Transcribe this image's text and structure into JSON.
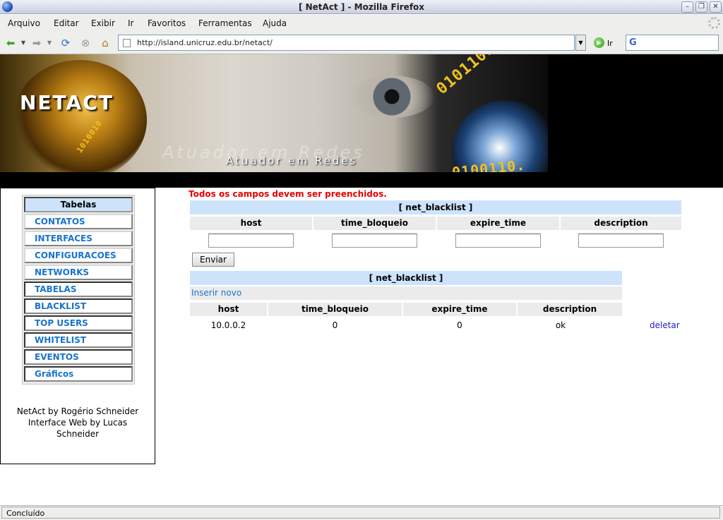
{
  "window": {
    "title": "[ NetAct ] - Mozilla Firefox",
    "controls": [
      "minimize",
      "maximize",
      "close"
    ]
  },
  "menubar": {
    "items": [
      "Arquivo",
      "Editar",
      "Exibir",
      "Ir",
      "Favoritos",
      "Ferramentas",
      "Ajuda"
    ]
  },
  "navbar": {
    "url": "http://island.unicruz.edu.br/netact/",
    "go_label": "Ir",
    "search_engine": "G"
  },
  "banner": {
    "title": "NETACT",
    "subtitle": "Atuador em Redes"
  },
  "sidebar": {
    "heading": "Tabelas",
    "links": [
      "CONTATOS",
      "INTERFACES",
      "CONFIGURACOES",
      "NETWORKS",
      "TABELAS",
      "BLACKLIST",
      "TOP USERS",
      "WHITELIST",
      "EVENTOS",
      "Gráficos"
    ],
    "credits": [
      "NetAct by Rogério Schneider",
      "Interface Web by Lucas",
      "Schneider"
    ]
  },
  "main": {
    "message": "Todos os campos devem ser preenchidos.",
    "form": {
      "table_title": "[ net_blacklist ]",
      "columns": [
        "host",
        "time_bloqueio",
        "expire_time",
        "description"
      ],
      "values": [
        "",
        "",
        "",
        ""
      ],
      "submit_label": "Enviar"
    },
    "list": {
      "table_title": "[ net_blacklist ]",
      "insert_label": "Inserir novo",
      "columns": [
        "host",
        "time_bloqueio",
        "expire_time",
        "description"
      ],
      "rows": [
        {
          "host": "10.0.0.2",
          "time_bloqueio": "0",
          "expire_time": "0",
          "description": "ok",
          "action": "deletar"
        }
      ]
    }
  },
  "statusbar": {
    "text": "Concluído"
  }
}
